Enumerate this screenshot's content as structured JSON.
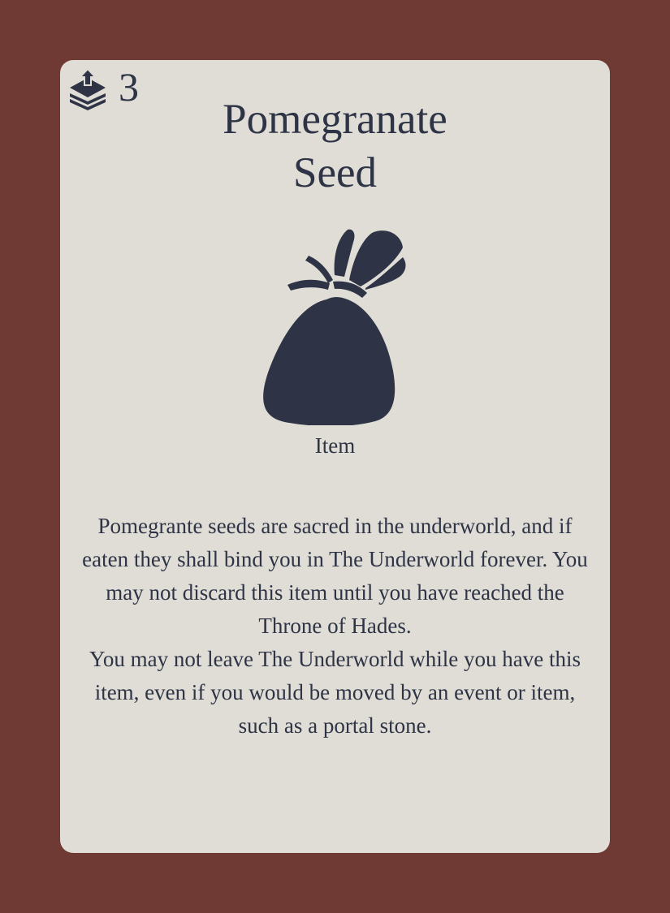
{
  "card": {
    "cost": "3",
    "cost_icon": "card-stack-upload-icon",
    "title_line1": "Pomegranate",
    "title_line2": "Seed",
    "art_icon": "sack-icon",
    "type": "Item",
    "description": [
      "Pomegrante seeds are sacred in the underworld, and if eaten they shall bind you in The Underworld forever. You may not discard this item until you have reached the Throne of Hades.",
      "You may not leave The Underworld while you have this item, even if you would be moved by an event or item, such as a portal stone."
    ]
  },
  "colors": {
    "background": "#6e3a33",
    "card": "#dfddd5",
    "ink": "#2e3446"
  }
}
